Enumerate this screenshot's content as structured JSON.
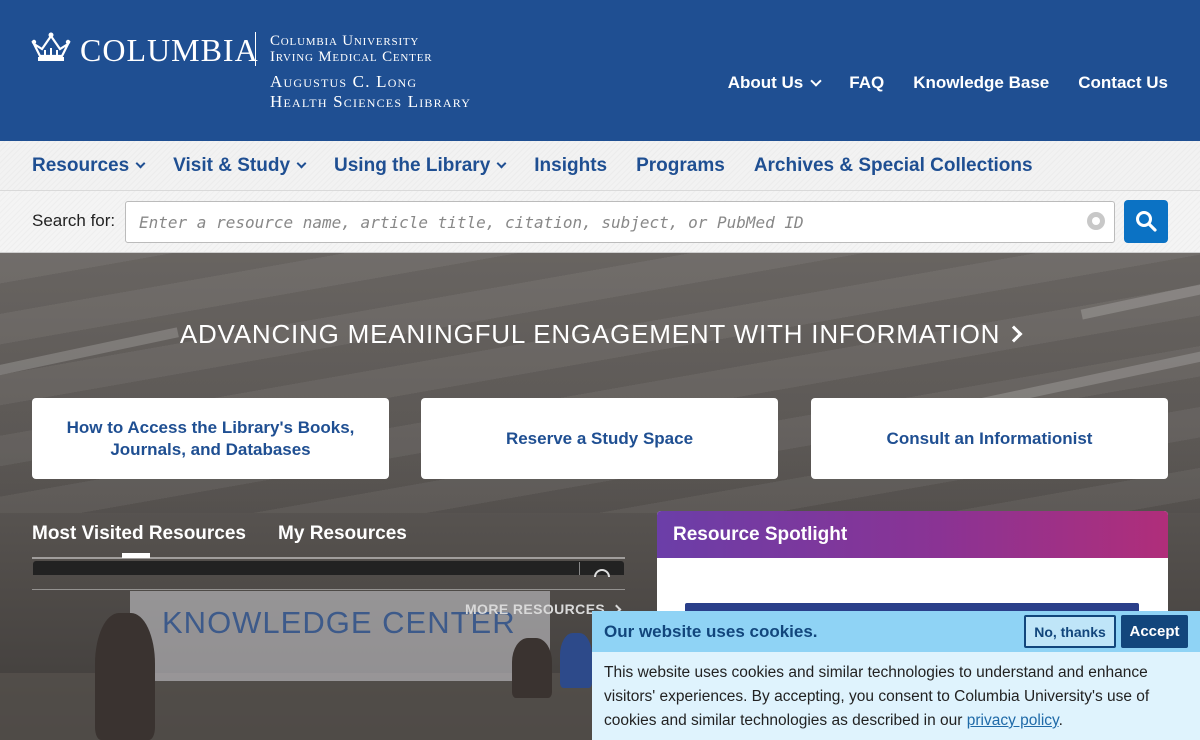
{
  "header": {
    "logo_text": "COLUMBIA",
    "cuimc_line1": "Columbia University",
    "cuimc_line2": "Irving Medical Center",
    "library_line1": "Augustus C. Long",
    "library_line2": "Health Sciences Library",
    "util_nav": [
      {
        "label": "About Us"
      },
      {
        "label": "FAQ"
      },
      {
        "label": "Knowledge Base"
      },
      {
        "label": "Contact Us"
      }
    ]
  },
  "main_nav": [
    {
      "label": "Resources"
    },
    {
      "label": "Visit & Study"
    },
    {
      "label": "Using the Library"
    },
    {
      "label": "Insights"
    },
    {
      "label": "Programs"
    },
    {
      "label": "Archives & Special Collections"
    }
  ],
  "search": {
    "label": "Search for:",
    "placeholder": "Enter a resource name, article title, citation, subject, or PubMed ID",
    "value": ""
  },
  "hero": {
    "title": "ADVANCING MEANINGFUL ENGAGEMENT WITH INFORMATION",
    "background_sign": "KNOWLEDGE CENTER",
    "ctas": [
      {
        "label": "How to Access the Library's Books, Journals, and Databases"
      },
      {
        "label": "Reserve a Study Space"
      },
      {
        "label": "Consult an Informationist"
      }
    ],
    "tabs": [
      {
        "label": "Most Visited Resources"
      },
      {
        "label": "My Resources"
      }
    ],
    "more_resources": "MORE RESOURCES"
  },
  "spotlight": {
    "title": "Resource Spotlight"
  },
  "cookie": {
    "title": "Our website uses cookies.",
    "no_label": "No, thanks",
    "accept_label": "Accept",
    "body": "This website uses cookies and similar technologies to understand and enhance visitors' experiences. By accepting, you consent to Columbia University's use of cookies and similar technologies as described in our ",
    "link": "privacy policy",
    "tail": "."
  },
  "colors": {
    "header_blue": "#1f4f92",
    "search_button": "#0b72c4",
    "cookie_header": "#8fd3f5",
    "cookie_dark": "#12467c"
  }
}
